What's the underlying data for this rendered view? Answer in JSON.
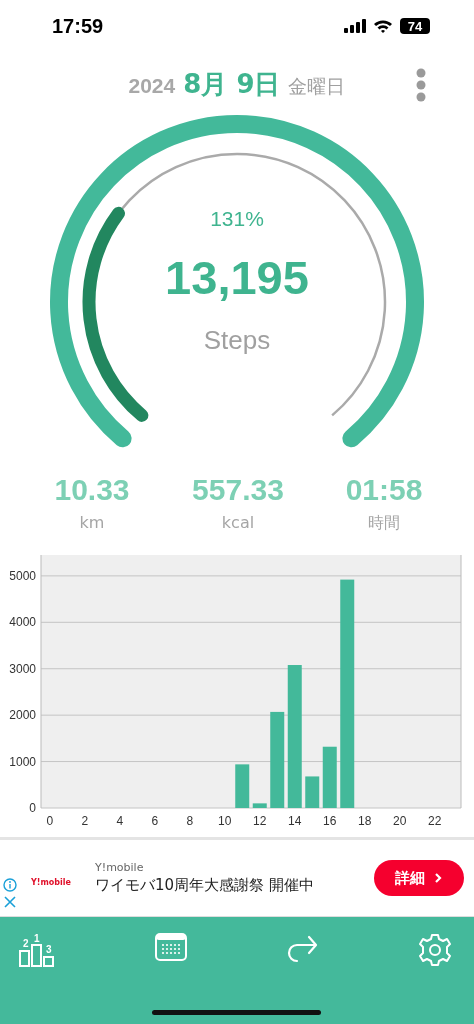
{
  "status_bar": {
    "time": "17:59",
    "battery": "74"
  },
  "header": {
    "year": "2024",
    "date": "8月 9日",
    "weekday": "金曜日"
  },
  "gauge": {
    "percent": "131%",
    "steps": "13,195",
    "unit": "Steps"
  },
  "stats": [
    {
      "value": "10.33",
      "label": "km"
    },
    {
      "value": "557.33",
      "label": "kcal"
    },
    {
      "value": "01:58",
      "label": "時間"
    }
  ],
  "chart_data": {
    "type": "bar",
    "grid": true,
    "x": [
      0,
      1,
      2,
      3,
      4,
      5,
      6,
      7,
      8,
      9,
      10,
      11,
      12,
      13,
      14,
      15,
      16,
      17,
      18,
      19,
      20,
      21,
      22,
      23
    ],
    "series": [
      {
        "color": "#43b99a",
        "values": [
          0,
          0,
          0,
          0,
          0,
          0,
          0,
          0,
          0,
          0,
          0,
          940,
          100,
          2070,
          3080,
          680,
          1320,
          4920,
          0,
          0,
          0,
          0,
          0,
          0
        ]
      }
    ],
    "xlim": [
      -0.5,
      23.5
    ],
    "ylim": [
      0,
      5450
    ],
    "xticks": [
      0,
      2,
      4,
      6,
      8,
      10,
      12,
      14,
      16,
      18,
      20,
      22
    ],
    "yticks": [
      0,
      1000,
      2000,
      3000,
      4000,
      5000
    ]
  },
  "ad": {
    "logo": "Y!mobile",
    "advertiser": "Y!mobile",
    "headline": "ワイモバ10周年大感謝祭 開催中",
    "button": "詳細"
  },
  "nav": [
    {
      "kind": "ranking",
      "digits": [
        "2",
        "1",
        "3"
      ]
    },
    {
      "kind": "calendar"
    },
    {
      "kind": "share"
    },
    {
      "kind": "settings"
    }
  ]
}
